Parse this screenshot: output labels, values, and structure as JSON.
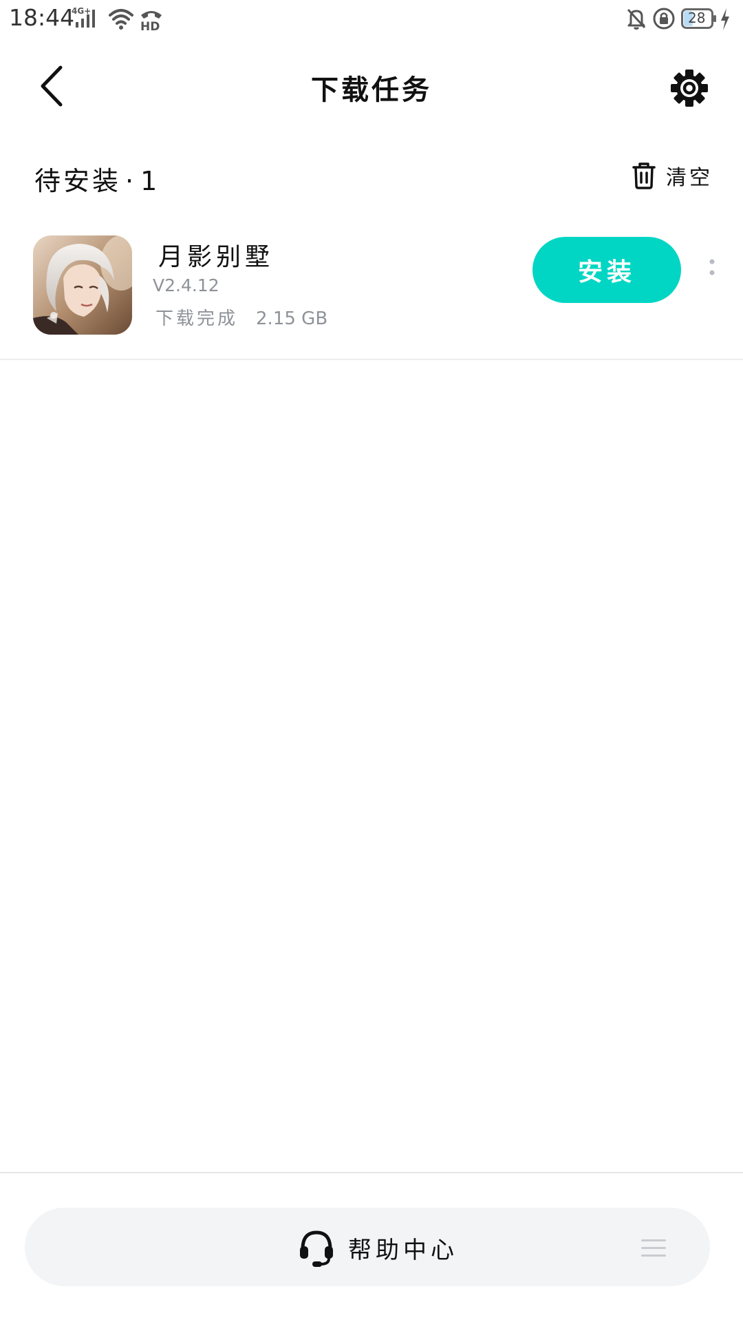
{
  "status_bar": {
    "time": "18:44",
    "network": "4G+",
    "signal_icon": "signal-bars-icon",
    "wifi_icon": "wifi-icon",
    "hd_icon": "hd-call-icon",
    "hd_label": "HD",
    "mute_icon": "notifications-off-icon",
    "lock_icon": "rotation-lock-icon",
    "battery_level": "28",
    "charging_icon": "charging-bolt-icon"
  },
  "header": {
    "title": "下载任务",
    "back_icon": "chevron-left-icon",
    "settings_icon": "gear-icon"
  },
  "section": {
    "title": "待安装",
    "separator": "·",
    "count": "1",
    "clear_label": "清空",
    "clear_icon": "trash-icon"
  },
  "downloads": [
    {
      "name": "月影别墅",
      "version": "V2.4.12",
      "status": "下载完成",
      "size": "2.15 GB",
      "action_label": "安装",
      "more_icon": "more-vertical-icon"
    }
  ],
  "footer": {
    "help_label": "帮助中心",
    "help_icon": "headset-icon",
    "menu_icon": "hamburger-menu-icon"
  },
  "colors": {
    "accent": "#00d6c3",
    "muted_text": "#8e9298",
    "footer_bg": "#f3f4f6"
  }
}
